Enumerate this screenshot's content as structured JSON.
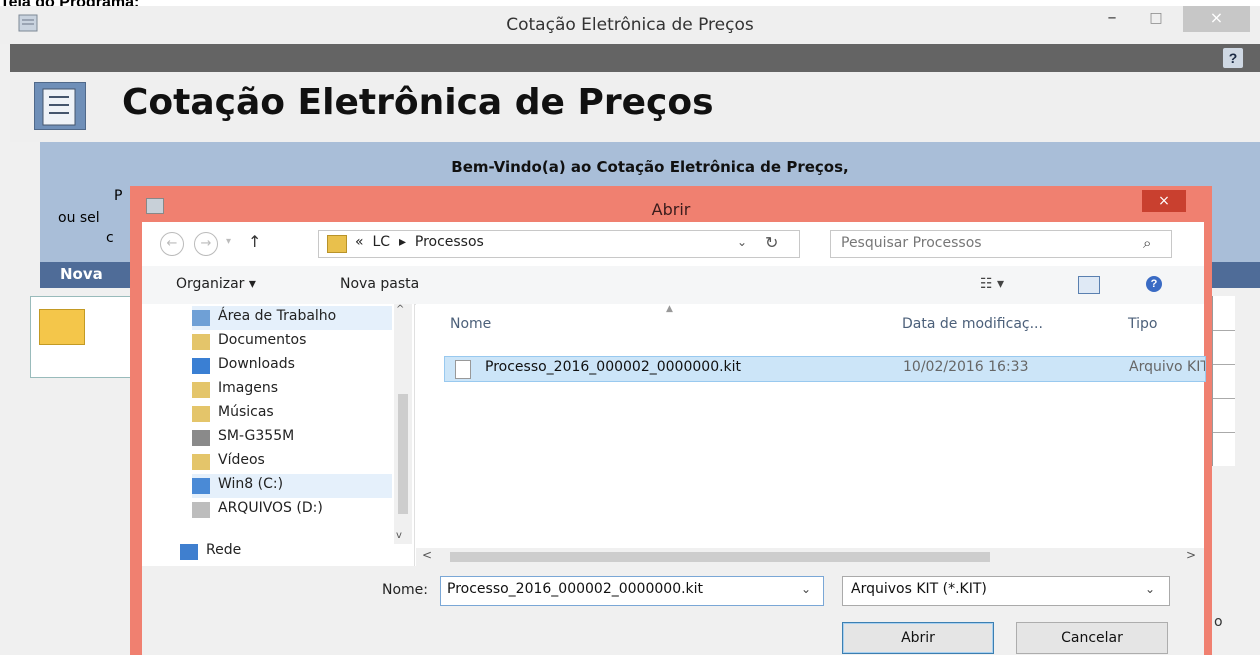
{
  "caption": "Tela do Programa:",
  "app": {
    "title": "Cotação Eletrônica de Preços",
    "header_title": "Cotação Eletrônica de Preços",
    "banner_text": "Bem-Vindo(a) ao Cotação Eletrônica de Preços,",
    "banner_fragments": [
      "P",
      "ou sel",
      "c"
    ],
    "section_label": "Nova",
    "stub_text": "o",
    "window_buttons": {
      "minimize": "–",
      "maximize": "□",
      "close": "×"
    },
    "help_icon": "?"
  },
  "dialog": {
    "title": "Abrir",
    "close": "×",
    "address": {
      "path": "«  LC  ▸  Processos",
      "back": "←",
      "forward": "→",
      "recent": "▾",
      "up": "↑",
      "dropdown": "⌄",
      "refresh": "↻"
    },
    "search_placeholder": "Pesquisar Processos",
    "search_icon": "⌕",
    "commands": {
      "organize": "Organizar ▾",
      "new_folder": "Nova pasta",
      "views": "☷ ▾",
      "help": "?"
    },
    "nav_items": [
      {
        "label": "Área de Trabalho",
        "icon": "desktop-icon",
        "color": "#6fa0d6"
      },
      {
        "label": "Documentos",
        "icon": "documents-icon",
        "color": "#e4c56a"
      },
      {
        "label": "Downloads",
        "icon": "downloads-icon",
        "color": "#3a7fd3"
      },
      {
        "label": "Imagens",
        "icon": "pictures-icon",
        "color": "#e4c56a"
      },
      {
        "label": "Músicas",
        "icon": "music-icon",
        "color": "#e4c56a"
      },
      {
        "label": "SM-G355M",
        "icon": "phone-icon",
        "color": "#8a8a8a"
      },
      {
        "label": "Vídeos",
        "icon": "videos-icon",
        "color": "#e4c56a"
      },
      {
        "label": "Win8 (C:)",
        "icon": "drive-c-icon",
        "color": "#4a8ad6"
      },
      {
        "label": "ARQUIVOS (D:)",
        "icon": "drive-d-icon",
        "color": "#bdbdbd"
      },
      {
        "label": "Rede",
        "icon": "network-icon",
        "color": "#3f7fcf"
      }
    ],
    "columns": {
      "name": "Nome",
      "date": "Data de modificaç...",
      "type": "Tipo"
    },
    "files": [
      {
        "name": "Processo_2016_000002_0000000.kit",
        "date": "10/02/2016 16:33",
        "type": "Arquivo KIT"
      }
    ],
    "name_label": "Nome:",
    "name_value": "Processo_2016_000002_0000000.kit",
    "filter_value": "Arquivos KIT (*.KIT)",
    "dropdown_glyph": "⌄",
    "open_button": "Abrir",
    "cancel_button": "Cancelar",
    "scroll_glyphs": {
      "up": "^",
      "down": "v",
      "left": "<",
      "right": ">"
    }
  }
}
